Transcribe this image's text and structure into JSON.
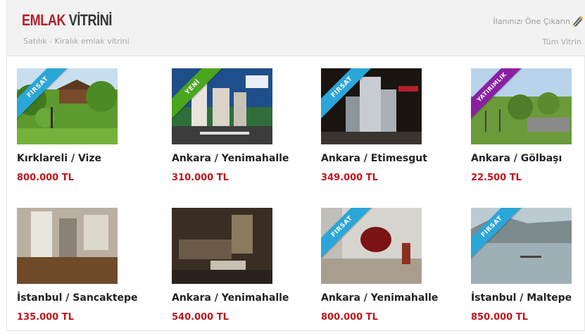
{
  "header": {
    "title_part1": "EMLAK",
    "title_part2": "VİTRİNİ",
    "subtitle": "Satılık - Kiralık emlak vitrini",
    "promo_link": "İlanınızı Öne Çıkarın",
    "all_link": "Tüm Vitrin"
  },
  "colors": {
    "accent": "#b3202b",
    "price": "#c0161c",
    "ribbon_blue": "#2aa6d9",
    "ribbon_green": "#4aa61c",
    "ribbon_purple": "#8b1fa3"
  },
  "listings": [
    {
      "location": "Kırklareli / Vize",
      "price": "800.000 TL",
      "badge": "FIRSAT"
    },
    {
      "location": "Ankara / Yenimahalle",
      "price": "310.000 TL",
      "badge": "YENİ"
    },
    {
      "location": "Ankara / Etimesgut",
      "price": "349.000 TL",
      "badge": "FIRSAT"
    },
    {
      "location": "Ankara / Gölbaşı",
      "price": "22.500 TL",
      "badge": "YATIRIMLIK"
    },
    {
      "location": "İstanbul / Sancaktepe",
      "price": "135.000 TL",
      "badge": ""
    },
    {
      "location": "Ankara / Yenimahalle",
      "price": "540.000 TL",
      "badge": ""
    },
    {
      "location": "Ankara / Yenimahalle",
      "price": "800.000 TL",
      "badge": "FIRSAT"
    },
    {
      "location": "İstanbul / Maltepe",
      "price": "850.000 TL",
      "badge": "FIRSAT"
    }
  ]
}
